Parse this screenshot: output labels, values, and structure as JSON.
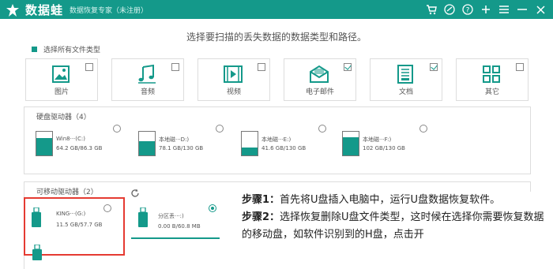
{
  "app": {
    "name": "数据蛙",
    "subtitle": "数据恢复专家（未注册）"
  },
  "window_buttons": [
    "cart-icon",
    "account-icon",
    "help-icon",
    "add-icon",
    "menu-icon",
    "minimize-icon",
    "close-icon"
  ],
  "heading": "选择要扫描的丢失数据的数据类型和路径。",
  "select_all": {
    "label": "选择所有文件类型",
    "checked": true
  },
  "file_types": [
    {
      "label": "图片",
      "icon": "image-icon",
      "checked": false
    },
    {
      "label": "音频",
      "icon": "audio-icon",
      "checked": false
    },
    {
      "label": "视频",
      "icon": "video-icon",
      "checked": false
    },
    {
      "label": "电子邮件",
      "icon": "email-icon",
      "checked": true
    },
    {
      "label": "文档",
      "icon": "document-icon",
      "checked": true
    },
    {
      "label": "其它",
      "icon": "other-icon",
      "checked": false
    }
  ],
  "hard_drives": {
    "title": "硬盘驱动器（4）",
    "items": [
      {
        "name": "Win8···(C:)",
        "size": "64.2 GB/86.3 GB",
        "used_fraction": 0.74,
        "selected": false
      },
      {
        "name": "本地磁···D:)",
        "size": "78.1 GB/130 GB",
        "used_fraction": 0.6,
        "selected": false
      },
      {
        "name": "本地磁···E:)",
        "size": "41.6 GB/130 GB",
        "used_fraction": 0.32,
        "selected": false
      },
      {
        "name": "本地磁···F:)",
        "size": "102 GB/130 GB",
        "used_fraction": 0.78,
        "selected": false
      }
    ]
  },
  "removable_drives": {
    "title": "可移动驱动器（2）",
    "items": [
      {
        "name": "KING···(G:)",
        "size": "11.5 GB/57.7 GB",
        "selected": false
      },
      {
        "name": "分区丢···:)",
        "size": "0.00  B/60.8 MB",
        "selected": true
      }
    ]
  },
  "tutorial": {
    "step1_label": "步骤1：",
    "step1_text": "首先将U盘插入电脑中，运行U盘数据恢复软件。",
    "step2_label": "步骤2：",
    "step2_text": "选择恢复删除U盘文件类型，这时候在选择你需要恢复数据的移动盘，如软件识别到的H盘，点击开"
  },
  "colors": {
    "brand": "#14998a",
    "highlight": "#e53b32"
  }
}
